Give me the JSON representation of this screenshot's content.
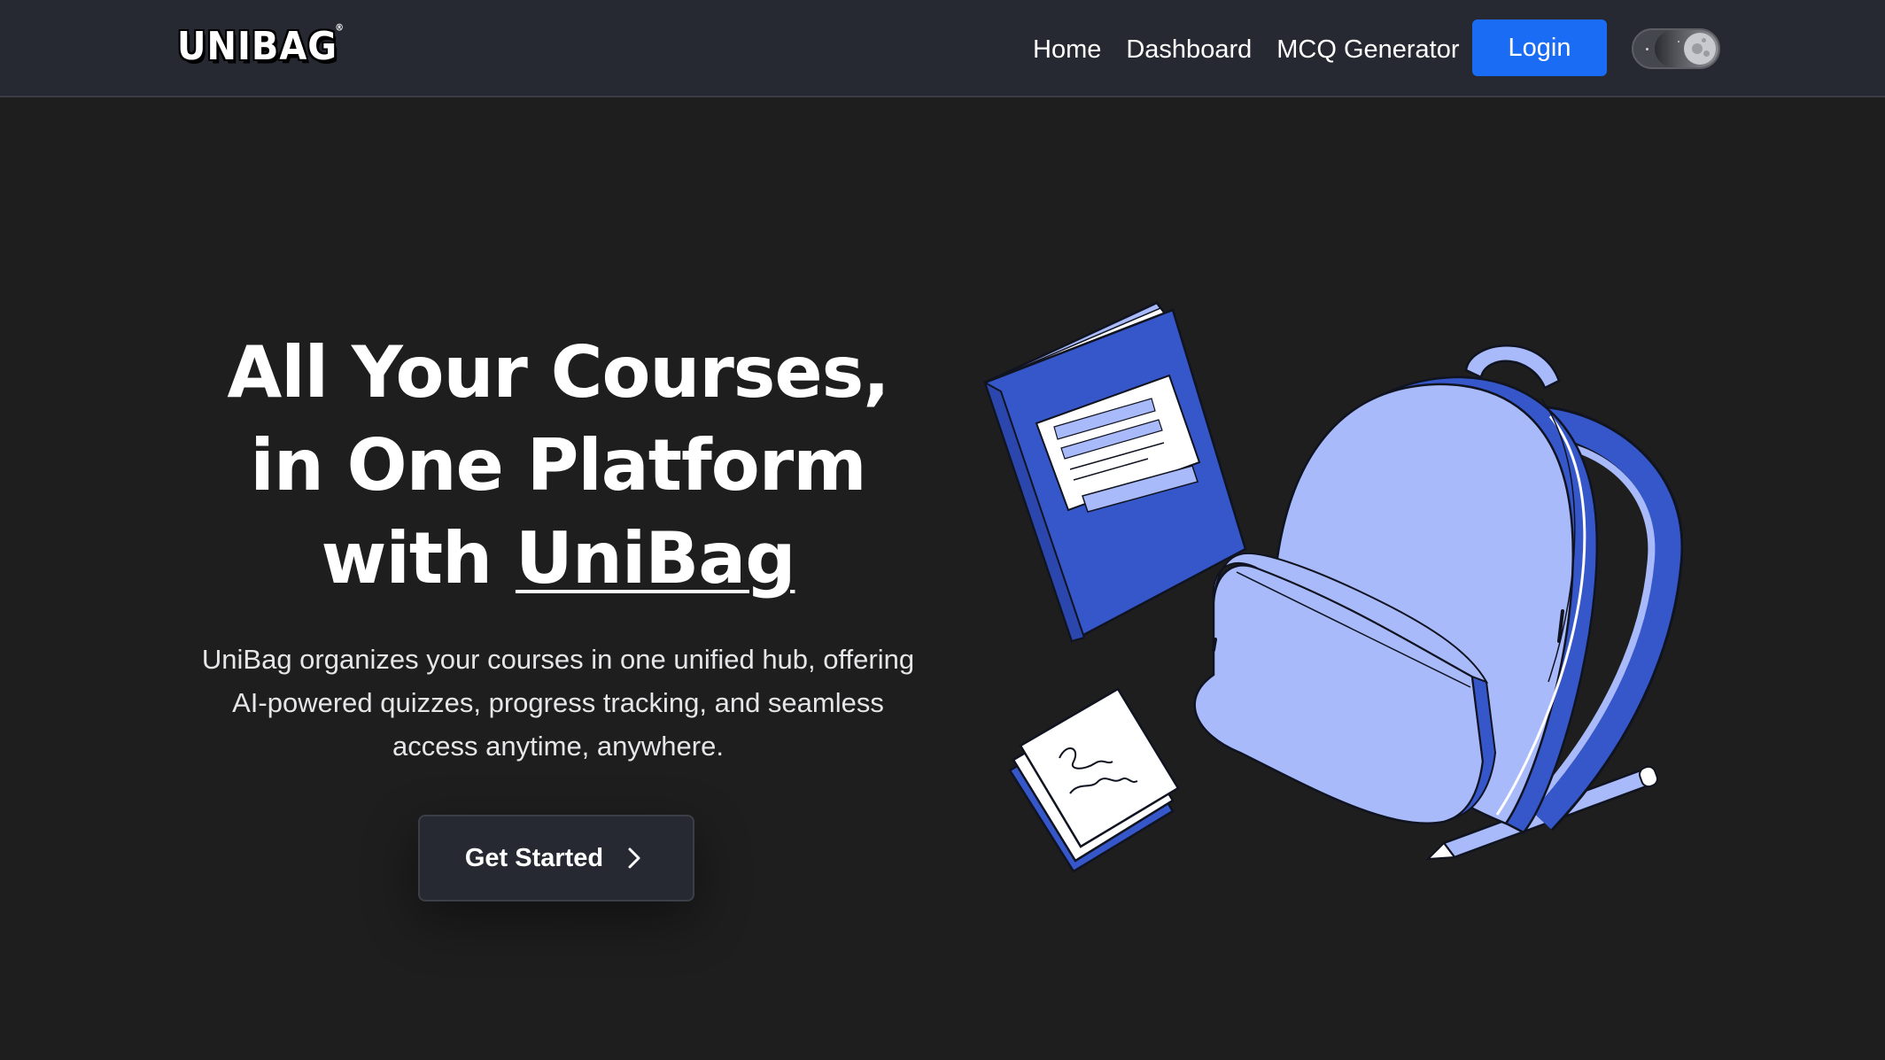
{
  "nav": {
    "logo": "UNIBAG",
    "links": [
      "Home",
      "Dashboard",
      "MCQ Generator"
    ],
    "login_label": "Login"
  },
  "hero": {
    "title_line1": "All Your Courses,",
    "title_line2": "in One Platform",
    "title_line3_prefix": "with ",
    "title_brand": "UniBag",
    "description": "UniBag organizes your courses in one unified hub, offering AI-powered quizzes, progress tracking, and seamless access anytime, anywhere.",
    "cta_label": "Get Started"
  },
  "icons": {
    "cta": "chevron-right-icon",
    "toggle": "moon-toggle-icon"
  },
  "colors": {
    "background": "#1e1e1f",
    "navbar": "#262932",
    "accent": "#1a6cf5",
    "illustration_light": "#a9bafa",
    "illustration_dark": "#3657c9"
  }
}
